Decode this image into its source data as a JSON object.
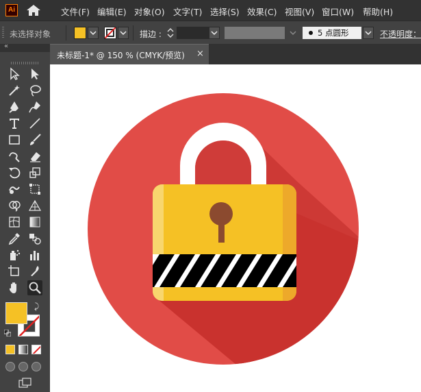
{
  "app": {
    "logo_text": "Ai",
    "logo_icon": "illustrator-logo-icon",
    "home_icon": "home-icon"
  },
  "menu": [
    "文件(F)",
    "编辑(E)",
    "对象(O)",
    "文字(T)",
    "选择(S)",
    "效果(C)",
    "视图(V)",
    "窗口(W)",
    "帮助(H)"
  ],
  "control_bar": {
    "selection_status": "未选择对象",
    "fill_color": "#f5c125",
    "stroke_color": "none",
    "stroke_label": "描边",
    "stroke_colon": ":",
    "stroke_weight": "",
    "brush_label": "5 点圆形",
    "opacity_label": "不透明度："
  },
  "tools_panel": {
    "collapse_icon": "double-chevron-left-icon",
    "tools": [
      "selection-tool-icon",
      "direct-selection-tool-icon",
      "magic-wand-tool-icon",
      "lasso-tool-icon",
      "pen-tool-icon",
      "curvature-tool-icon",
      "type-tool-icon",
      "line-segment-tool-icon",
      "rectangle-tool-icon",
      "paintbrush-tool-icon",
      "shaper-tool-icon",
      "eraser-tool-icon",
      "rotate-tool-icon",
      "scale-tool-icon",
      "warp-tool-icon",
      "free-transform-tool-icon",
      "shape-builder-tool-icon",
      "perspective-grid-tool-icon",
      "mesh-tool-icon",
      "gradient-tool-icon",
      "eyedropper-tool-icon",
      "blend-tool-icon",
      "symbol-sprayer-tool-icon",
      "column-graph-tool-icon",
      "artboard-tool-icon",
      "slice-tool-icon",
      "hand-tool-icon",
      "zoom-tool-icon"
    ],
    "active_tool": "zoom-tool-icon",
    "fill_color": "#f5c125",
    "stroke_color": "none"
  },
  "document_tab": {
    "title": "未标题-1* @ 150 % (CMYK/预览)",
    "close_label": "×"
  },
  "artwork": {
    "circle_color": "#e14c47",
    "shadow_color": "#c9322e",
    "shackle_color": "#ffffff",
    "shackle_inner_color": "#cf3c39",
    "body_color": "#f5c125",
    "body_left_color": "#f8d66e",
    "body_right_color": "#eda92a",
    "keyhole_color": "#8b4a2f",
    "stripe_colors": [
      "#000000",
      "#ffffff"
    ]
  }
}
